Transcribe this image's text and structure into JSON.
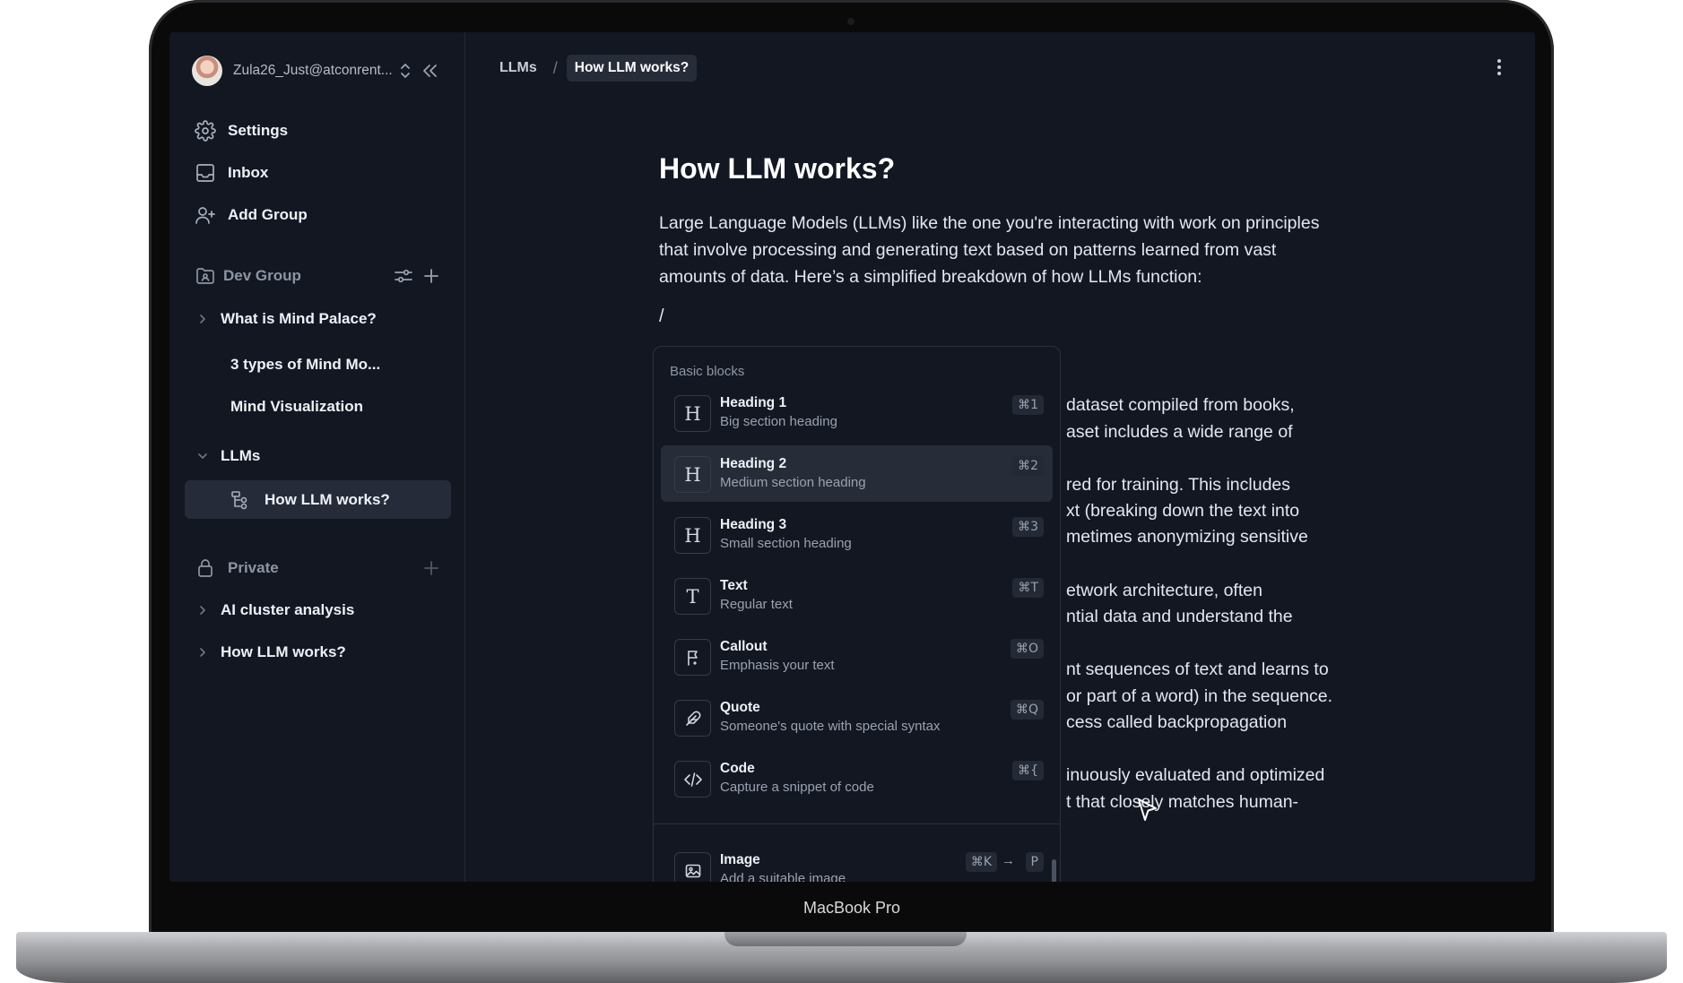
{
  "device": {
    "label": "MacBook Pro"
  },
  "account": {
    "name": "Zula26_Just@atconrent..."
  },
  "sidebar": {
    "nav": [
      {
        "label": "Settings",
        "icon": "gear-icon"
      },
      {
        "label": "Inbox",
        "icon": "inbox-icon"
      },
      {
        "label": "Add Group",
        "icon": "add-user-icon"
      }
    ],
    "dev_group": {
      "label": "Dev Group",
      "items": [
        "What is Mind Palace?",
        "3 types of Mind Mo...",
        "Mind Visualization",
        "LLMs",
        "How LLM works?"
      ]
    },
    "private": {
      "label": "Private",
      "items": [
        "AI cluster analysis",
        "How LLM works?"
      ]
    }
  },
  "breadcrumb": {
    "parent": "LLMs",
    "separator": "/",
    "current": "How LLM works?"
  },
  "document": {
    "title": "How LLM works?",
    "intro": "Large Language Models (LLMs) like the one you're interacting with work on principles that involve processing and generating text based on patterns learned from vast amounts of data. Here’s a simplified breakdown of how LLMs function:",
    "slash": "/",
    "lines": [
      " dataset compiled from books,",
      "aset includes a wide range of",
      "red for training. This includes",
      "xt (breaking down the text into",
      "metimes anonymizing sensitive",
      "etwork architecture, often",
      "ntial data and understand the",
      "nt sequences of text and learns to",
      "or part of a word) in the sequence.",
      "cess called backpropagation",
      "inuously evaluated and optimized",
      "t that closely matches human-"
    ]
  },
  "menu": {
    "heading": "Basic blocks",
    "items": [
      {
        "label": "Heading 1",
        "desc": "Big section heading",
        "shortcut": "⌘1",
        "icon": "heading-icon",
        "glyph": "H"
      },
      {
        "label": "Heading 2",
        "desc": "Medium section heading",
        "shortcut": "⌘2",
        "icon": "heading-icon",
        "glyph": "H",
        "active": true
      },
      {
        "label": "Heading 3",
        "desc": "Small section heading",
        "shortcut": "⌘3",
        "icon": "heading-icon",
        "glyph": "H"
      },
      {
        "label": "Text",
        "desc": "Regular text",
        "shortcut": "⌘T",
        "icon": "text-icon",
        "glyph": "T"
      },
      {
        "label": "Callout",
        "desc": "Emphasis your text",
        "shortcut": "⌘O",
        "icon": "flag-icon"
      },
      {
        "label": "Quote",
        "desc": "Someone's quote with special syntax",
        "shortcut": "⌘Q",
        "icon": "feather-icon"
      },
      {
        "label": "Code",
        "desc": "Capture a snippet of code",
        "shortcut": "⌘{",
        "icon": "code-icon"
      },
      {
        "label": "Image",
        "desc": "Add a suitable image",
        "shortcut": "⌘K",
        "shortcut2": "P",
        "icon": "image-icon"
      }
    ]
  },
  "colors": {
    "background": "#121722",
    "active_row": "#262c38",
    "text": "#eef1f6",
    "muted": "#9aa2b0"
  }
}
